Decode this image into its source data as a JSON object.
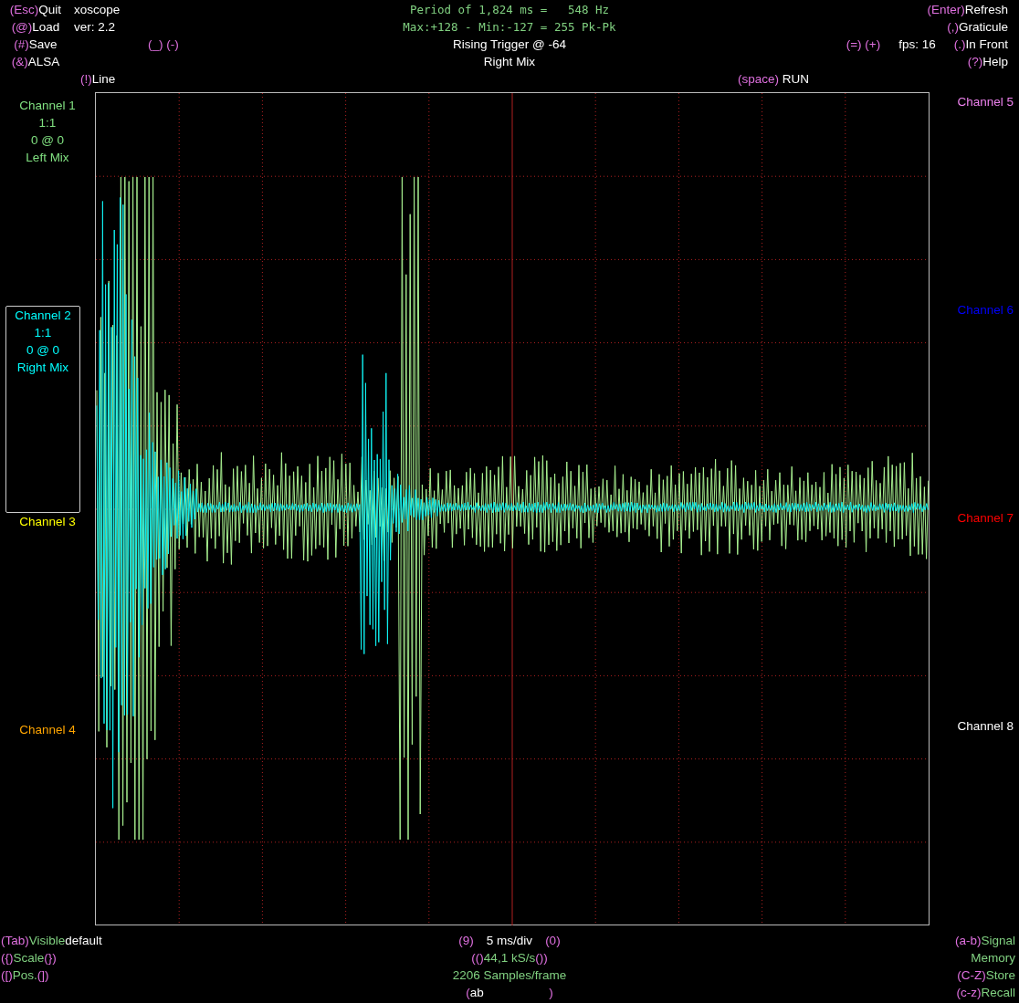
{
  "header": {
    "rows": [
      {
        "left": [
          {
            "parts": [
              {
                "text": "(Esc)",
                "kind": "key"
              },
              {
                "text": "Quit",
                "kind": "label"
              }
            ]
          },
          {
            "parts": [
              {
                "text": "xoscope",
                "kind": "label"
              }
            ]
          }
        ],
        "center": [
          {
            "parts": [
              {
                "text": "Period of 1,824 ms =   548 Hz",
                "kind": "readout"
              }
            ]
          }
        ],
        "right": [
          {
            "parts": [
              {
                "text": "(Enter)",
                "kind": "key"
              },
              {
                "text": "Refresh",
                "kind": "label"
              }
            ]
          }
        ]
      },
      {
        "left": [
          {
            "parts": [
              {
                "text": "(@)",
                "kind": "key"
              },
              {
                "text": "Load",
                "kind": "label"
              }
            ]
          },
          {
            "parts": [
              {
                "text": "ver: 2.2",
                "kind": "label"
              }
            ]
          }
        ],
        "center": [
          {
            "parts": [
              {
                "text": "Max:+128 - Min:-127 = 255 Pk-Pk",
                "kind": "readout"
              }
            ]
          }
        ],
        "right": [
          {
            "parts": [
              {
                "text": "(,)",
                "kind": "key"
              },
              {
                "text": "Graticule",
                "kind": "label"
              }
            ]
          }
        ]
      },
      {
        "left": [
          {
            "parts": [
              {
                "text": "(#)",
                "kind": "key"
              },
              {
                "text": "Save",
                "kind": "label"
              }
            ]
          },
          {
            "parts": [
              {
                "text": "(_) (-)",
                "kind": "key"
              }
            ]
          }
        ],
        "center": [
          {
            "parts": [
              {
                "text": "Rising Trigger @ -64",
                "kind": "label"
              }
            ]
          }
        ],
        "right": [
          {
            "parts": [
              {
                "text": "(=) (+)",
                "kind": "key"
              }
            ]
          },
          {
            "parts": [
              {
                "text": "fps: 16",
                "kind": "label"
              }
            ]
          },
          {
            "parts": [
              {
                "text": "(.)",
                "kind": "key"
              },
              {
                "text": "In Front",
                "kind": "label"
              }
            ]
          }
        ]
      },
      {
        "left": [
          {
            "parts": [
              {
                "text": "(&)",
                "kind": "key"
              },
              {
                "text": "ALSA",
                "kind": "label"
              }
            ]
          }
        ],
        "center": [
          {
            "parts": [
              {
                "text": "Right Mix",
                "kind": "label"
              }
            ]
          }
        ],
        "right": [
          {
            "parts": [
              {
                "text": "(?)",
                "kind": "key"
              },
              {
                "text": "Help",
                "kind": "label"
              }
            ]
          }
        ]
      },
      {
        "left": [
          {
            "parts": [
              {
                "text": "(!)",
                "kind": "key"
              },
              {
                "text": "Line",
                "kind": "label"
              }
            ]
          }
        ],
        "right": [
          {
            "parts": [
              {
                "text": "(space)",
                "kind": "key"
              },
              {
                "text": " RUN",
                "kind": "label"
              }
            ]
          }
        ]
      }
    ]
  },
  "channels_left": [
    {
      "name": "Channel 1",
      "color": "#80e080",
      "selected": false,
      "details": [
        "1:1",
        "0 @ 0",
        "Left Mix"
      ]
    },
    {
      "name": "Channel 2",
      "color": "#00ffff",
      "selected": true,
      "details": [
        "1:1",
        "0 @ 0",
        "Right Mix"
      ]
    },
    {
      "name": "Channel 3",
      "color": "#ffff00",
      "selected": false
    },
    {
      "name": "Channel 4",
      "color": "#ffa500",
      "selected": false
    }
  ],
  "channels_right": [
    {
      "name": "Channel 5",
      "color": "#ee82ee",
      "selected": false
    },
    {
      "name": "Channel 6",
      "color": "#0000ff",
      "selected": false
    },
    {
      "name": "Channel 7",
      "color": "#ff0000",
      "selected": false
    },
    {
      "name": "Channel 8",
      "color": "#ffffff",
      "selected": false
    }
  ],
  "footer": {
    "rows": [
      {
        "left": [
          {
            "parts": [
              {
                "text": "(Tab)",
                "kind": "key"
              },
              {
                "text": "Visible",
                "kind": "info"
              },
              {
                "text": "default",
                "kind": "label"
              }
            ]
          }
        ],
        "center": [
          {
            "parts": [
              {
                "text": "(9)",
                "kind": "key"
              }
            ]
          },
          {
            "parts": [
              {
                "text": "5 ms/div",
                "kind": "label"
              }
            ]
          },
          {
            "parts": [
              {
                "text": "(0)",
                "kind": "key"
              }
            ]
          }
        ],
        "right": [
          {
            "parts": [
              {
                "text": "(a-b)",
                "kind": "key"
              },
              {
                "text": "Signal",
                "kind": "info"
              }
            ]
          }
        ]
      },
      {
        "left": [
          {
            "parts": [
              {
                "text": "({)",
                "kind": "key"
              },
              {
                "text": "Scale",
                "kind": "info"
              },
              {
                "text": "(})",
                "kind": "key"
              }
            ]
          }
        ],
        "center": [
          {
            "parts": [
              {
                "text": "(()",
                "kind": "key"
              },
              {
                "text": "44,1 kS/s",
                "kind": "info"
              },
              {
                "text": "())",
                "kind": "key"
              }
            ]
          }
        ],
        "right": [
          {
            "parts": [
              {
                "text": "Memory",
                "kind": "info"
              }
            ]
          }
        ]
      },
      {
        "left": [
          {
            "parts": [
              {
                "text": "([)",
                "kind": "key"
              },
              {
                "text": "Pos.",
                "kind": "info"
              },
              {
                "text": "(])",
                "kind": "key"
              }
            ]
          }
        ],
        "center": [
          {
            "parts": [
              {
                "text": "2206 Samples/frame",
                "kind": "info"
              }
            ]
          }
        ],
        "right": [
          {
            "parts": [
              {
                "text": "(C-Z)",
                "kind": "key"
              },
              {
                "text": "Store",
                "kind": "info"
              }
            ]
          }
        ]
      },
      {
        "center": [
          {
            "parts": [
              {
                "text": "(",
                "kind": "key"
              },
              {
                "text": "ab                   ",
                "kind": "label"
              },
              {
                "text": ")",
                "kind": "key"
              }
            ]
          }
        ],
        "right": [
          {
            "parts": [
              {
                "text": "(c-z)",
                "kind": "key"
              },
              {
                "text": "Recall",
                "kind": "info"
              }
            ]
          }
        ]
      }
    ]
  }
}
